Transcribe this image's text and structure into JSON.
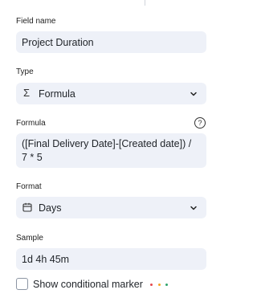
{
  "field_name": {
    "label": "Field name",
    "value": "Project Duration"
  },
  "type": {
    "label": "Type",
    "value": "Formula",
    "icon": "sigma-icon",
    "icon_glyph": "Σ"
  },
  "formula": {
    "label": "Formula",
    "help_glyph": "?",
    "line1": "([Final Delivery Date]-[Created date]) /",
    "line2": "7 * 5"
  },
  "format": {
    "label": "Format",
    "value": "Days",
    "icon": "calendar-icon"
  },
  "sample": {
    "label": "Sample",
    "value": "1d 4h 45m"
  },
  "conditional_marker": {
    "label": "Show conditional marker",
    "checked": false,
    "dot_colors": [
      "#e5484d",
      "#f5a524",
      "#30a46c"
    ]
  }
}
